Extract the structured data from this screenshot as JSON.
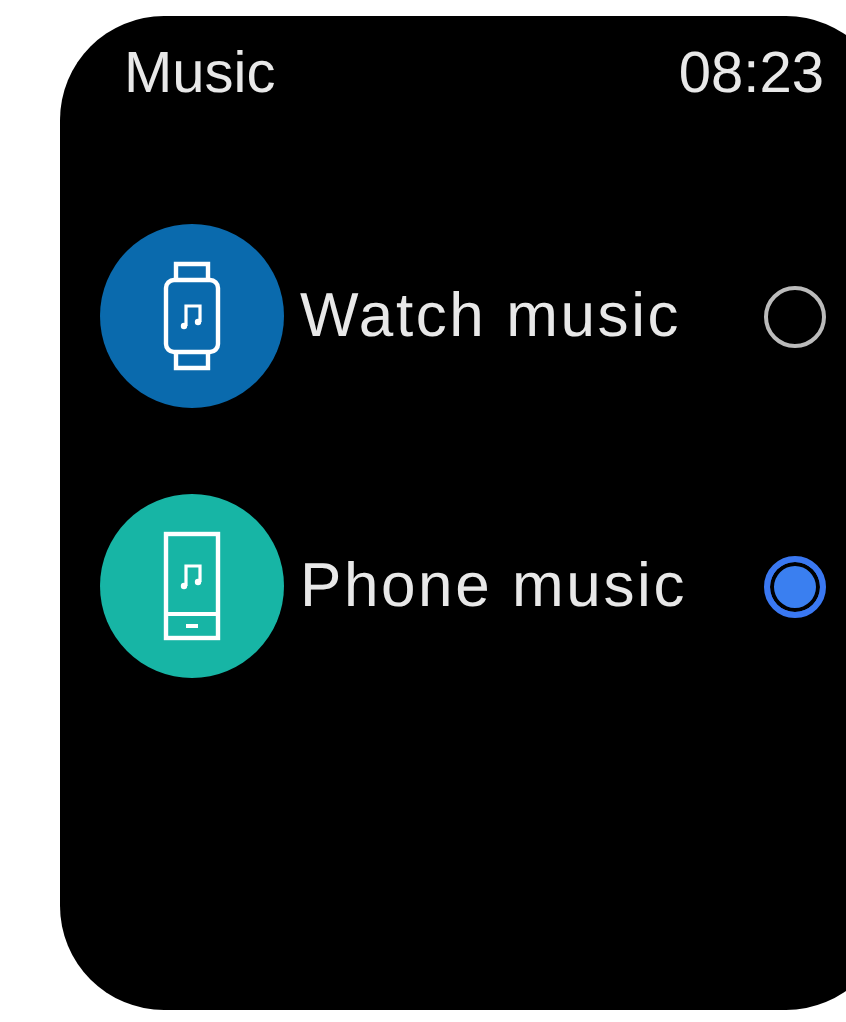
{
  "header": {
    "title": "Music",
    "time": "08:23"
  },
  "options": [
    {
      "kind": "watch",
      "label": "Watch music",
      "selected": false
    },
    {
      "kind": "phone",
      "label": "Phone music",
      "selected": true
    }
  ]
}
